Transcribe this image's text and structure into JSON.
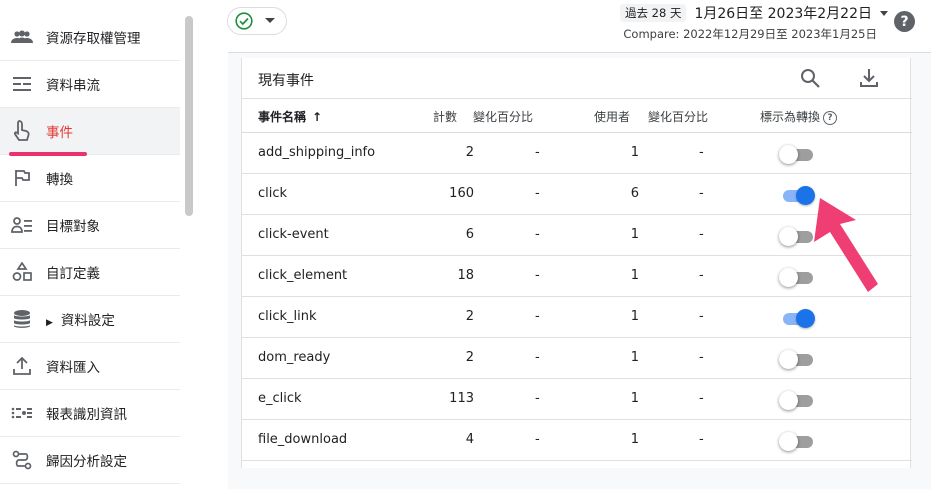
{
  "sidebar": {
    "items": [
      {
        "label": "資源存取權管理",
        "icon": "people-icon"
      },
      {
        "label": "資料串流",
        "icon": "data-stream-icon"
      },
      {
        "label": "事件",
        "icon": "touch-icon",
        "active": true
      },
      {
        "label": "轉換",
        "icon": "flag-icon"
      },
      {
        "label": "目標對象",
        "icon": "audience-icon"
      },
      {
        "label": "自訂定義",
        "icon": "shapes-icon"
      },
      {
        "label": "資料設定",
        "icon": "database-icon"
      },
      {
        "label": "資料匯入",
        "icon": "upload-icon"
      },
      {
        "label": "報表識別資訊",
        "icon": "reporting-identity-icon"
      },
      {
        "label": "歸因分析設定",
        "icon": "attribution-icon"
      }
    ]
  },
  "header": {
    "period_chip": "過去 28 天",
    "date_range": "1月26日至 2023年2月22日",
    "compare": "Compare: 2022年12月29日至 2023年1月25日",
    "help": "?"
  },
  "card": {
    "title": "現有事件",
    "columns": {
      "name": "事件名稱",
      "sort_arrow": "↑",
      "count": "計數",
      "count_pct": "變化百分比",
      "users": "使用者",
      "users_pct": "變化百分比",
      "conversion": "標示為轉換",
      "conversion_help": "?"
    },
    "rows": [
      {
        "name": "add_shipping_info",
        "count": "2",
        "count_pct": "-",
        "users": "1",
        "users_pct": "-",
        "conversion": false
      },
      {
        "name": "click",
        "count": "160",
        "count_pct": "-",
        "users": "6",
        "users_pct": "-",
        "conversion": true
      },
      {
        "name": "click-event",
        "count": "6",
        "count_pct": "-",
        "users": "1",
        "users_pct": "-",
        "conversion": false
      },
      {
        "name": "click_element",
        "count": "18",
        "count_pct": "-",
        "users": "1",
        "users_pct": "-",
        "conversion": false
      },
      {
        "name": "click_link",
        "count": "2",
        "count_pct": "-",
        "users": "1",
        "users_pct": "-",
        "conversion": true
      },
      {
        "name": "dom_ready",
        "count": "2",
        "count_pct": "-",
        "users": "1",
        "users_pct": "-",
        "conversion": false
      },
      {
        "name": "e_click",
        "count": "113",
        "count_pct": "-",
        "users": "1",
        "users_pct": "-",
        "conversion": false
      },
      {
        "name": "file_download",
        "count": "4",
        "count_pct": "-",
        "users": "1",
        "users_pct": "-",
        "conversion": false
      }
    ]
  },
  "colors": {
    "accent": "#1a73e8",
    "active_nav": "#e53935",
    "annotation_arrow": "#ef3e73"
  }
}
